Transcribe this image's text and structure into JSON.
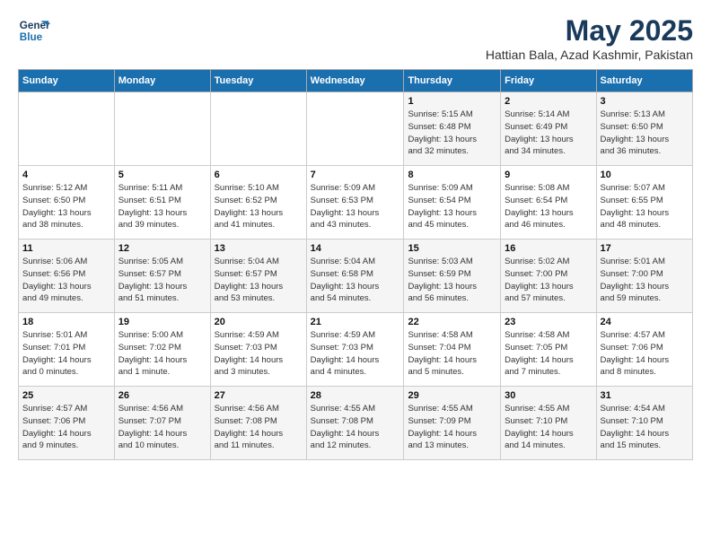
{
  "logo": {
    "line1": "General",
    "line2": "Blue"
  },
  "title": "May 2025",
  "subtitle": "Hattian Bala, Azad Kashmir, Pakistan",
  "weekdays": [
    "Sunday",
    "Monday",
    "Tuesday",
    "Wednesday",
    "Thursday",
    "Friday",
    "Saturday"
  ],
  "weeks": [
    [
      {
        "day": "",
        "info": ""
      },
      {
        "day": "",
        "info": ""
      },
      {
        "day": "",
        "info": ""
      },
      {
        "day": "",
        "info": ""
      },
      {
        "day": "1",
        "info": "Sunrise: 5:15 AM\nSunset: 6:48 PM\nDaylight: 13 hours\nand 32 minutes."
      },
      {
        "day": "2",
        "info": "Sunrise: 5:14 AM\nSunset: 6:49 PM\nDaylight: 13 hours\nand 34 minutes."
      },
      {
        "day": "3",
        "info": "Sunrise: 5:13 AM\nSunset: 6:50 PM\nDaylight: 13 hours\nand 36 minutes."
      }
    ],
    [
      {
        "day": "4",
        "info": "Sunrise: 5:12 AM\nSunset: 6:50 PM\nDaylight: 13 hours\nand 38 minutes."
      },
      {
        "day": "5",
        "info": "Sunrise: 5:11 AM\nSunset: 6:51 PM\nDaylight: 13 hours\nand 39 minutes."
      },
      {
        "day": "6",
        "info": "Sunrise: 5:10 AM\nSunset: 6:52 PM\nDaylight: 13 hours\nand 41 minutes."
      },
      {
        "day": "7",
        "info": "Sunrise: 5:09 AM\nSunset: 6:53 PM\nDaylight: 13 hours\nand 43 minutes."
      },
      {
        "day": "8",
        "info": "Sunrise: 5:09 AM\nSunset: 6:54 PM\nDaylight: 13 hours\nand 45 minutes."
      },
      {
        "day": "9",
        "info": "Sunrise: 5:08 AM\nSunset: 6:54 PM\nDaylight: 13 hours\nand 46 minutes."
      },
      {
        "day": "10",
        "info": "Sunrise: 5:07 AM\nSunset: 6:55 PM\nDaylight: 13 hours\nand 48 minutes."
      }
    ],
    [
      {
        "day": "11",
        "info": "Sunrise: 5:06 AM\nSunset: 6:56 PM\nDaylight: 13 hours\nand 49 minutes."
      },
      {
        "day": "12",
        "info": "Sunrise: 5:05 AM\nSunset: 6:57 PM\nDaylight: 13 hours\nand 51 minutes."
      },
      {
        "day": "13",
        "info": "Sunrise: 5:04 AM\nSunset: 6:57 PM\nDaylight: 13 hours\nand 53 minutes."
      },
      {
        "day": "14",
        "info": "Sunrise: 5:04 AM\nSunset: 6:58 PM\nDaylight: 13 hours\nand 54 minutes."
      },
      {
        "day": "15",
        "info": "Sunrise: 5:03 AM\nSunset: 6:59 PM\nDaylight: 13 hours\nand 56 minutes."
      },
      {
        "day": "16",
        "info": "Sunrise: 5:02 AM\nSunset: 7:00 PM\nDaylight: 13 hours\nand 57 minutes."
      },
      {
        "day": "17",
        "info": "Sunrise: 5:01 AM\nSunset: 7:00 PM\nDaylight: 13 hours\nand 59 minutes."
      }
    ],
    [
      {
        "day": "18",
        "info": "Sunrise: 5:01 AM\nSunset: 7:01 PM\nDaylight: 14 hours\nand 0 minutes."
      },
      {
        "day": "19",
        "info": "Sunrise: 5:00 AM\nSunset: 7:02 PM\nDaylight: 14 hours\nand 1 minute."
      },
      {
        "day": "20",
        "info": "Sunrise: 4:59 AM\nSunset: 7:03 PM\nDaylight: 14 hours\nand 3 minutes."
      },
      {
        "day": "21",
        "info": "Sunrise: 4:59 AM\nSunset: 7:03 PM\nDaylight: 14 hours\nand 4 minutes."
      },
      {
        "day": "22",
        "info": "Sunrise: 4:58 AM\nSunset: 7:04 PM\nDaylight: 14 hours\nand 5 minutes."
      },
      {
        "day": "23",
        "info": "Sunrise: 4:58 AM\nSunset: 7:05 PM\nDaylight: 14 hours\nand 7 minutes."
      },
      {
        "day": "24",
        "info": "Sunrise: 4:57 AM\nSunset: 7:06 PM\nDaylight: 14 hours\nand 8 minutes."
      }
    ],
    [
      {
        "day": "25",
        "info": "Sunrise: 4:57 AM\nSunset: 7:06 PM\nDaylight: 14 hours\nand 9 minutes."
      },
      {
        "day": "26",
        "info": "Sunrise: 4:56 AM\nSunset: 7:07 PM\nDaylight: 14 hours\nand 10 minutes."
      },
      {
        "day": "27",
        "info": "Sunrise: 4:56 AM\nSunset: 7:08 PM\nDaylight: 14 hours\nand 11 minutes."
      },
      {
        "day": "28",
        "info": "Sunrise: 4:55 AM\nSunset: 7:08 PM\nDaylight: 14 hours\nand 12 minutes."
      },
      {
        "day": "29",
        "info": "Sunrise: 4:55 AM\nSunset: 7:09 PM\nDaylight: 14 hours\nand 13 minutes."
      },
      {
        "day": "30",
        "info": "Sunrise: 4:55 AM\nSunset: 7:10 PM\nDaylight: 14 hours\nand 14 minutes."
      },
      {
        "day": "31",
        "info": "Sunrise: 4:54 AM\nSunset: 7:10 PM\nDaylight: 14 hours\nand 15 minutes."
      }
    ]
  ]
}
